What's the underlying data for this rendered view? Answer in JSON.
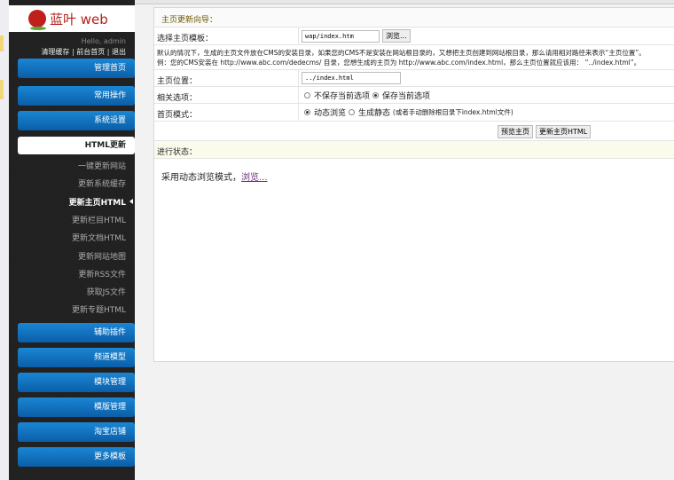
{
  "brand": {
    "name": "蓝叶 web"
  },
  "user": {
    "greeting": "Hello, admin",
    "links": [
      "清理缓存",
      "前台首页",
      "退出"
    ]
  },
  "sidebar": {
    "top_buttons": [
      "管理首页",
      "常用操作",
      "系统设置"
    ],
    "active_group": "HTML更新",
    "sub_items": [
      "一键更新网站",
      "更新系统缓存",
      "更新主页HTML",
      "更新栏目HTML",
      "更新文档HTML",
      "更新网站地图",
      "更新RSS文件",
      "获取JS文件",
      "更新专题HTML"
    ],
    "active_sub": 2,
    "bottom_buttons": [
      "辅助插件",
      "频道模型",
      "模块管理",
      "模版管理",
      "淘宝店铺",
      "更多模板"
    ]
  },
  "main": {
    "title": "主页更新向导：",
    "template_label": "选择主页模板：",
    "template_value": "wap/index.htm",
    "browse_button": "浏览...",
    "note_line1": "默认的情况下，生成的主页文件放在CMS的安装目录，如果您的CMS不是安装在网站根目录的，又想把主页创建到网站根目录，那么请用相对路径来表示“主页位置”。",
    "note_line2": "例：您的CMS安装在 http://www.abc.com/dedecms/ 目录，您想生成的主页为 http://www.abc.com/index.html，那么主页位置就应该用： “../index.html”。",
    "location_label": "主页位置：",
    "location_value": "../index.html",
    "options_label": "相关选项：",
    "option_no_save": "不保存当前选项",
    "option_save": "保存当前选项",
    "mode_label": "首页模式：",
    "mode_dynamic": "动态浏览",
    "mode_static": "生成静态",
    "mode_static_hint": "(或者手动删除根目录下index.html文件)",
    "preview_button": "预览主页",
    "update_button": "更新主页HTML",
    "status_label": "进行状态：",
    "status_message": "采用动态浏览模式，",
    "status_link": "浏览..."
  }
}
